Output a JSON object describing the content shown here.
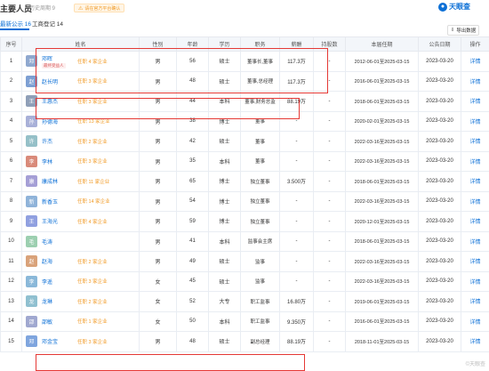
{
  "header": {
    "title": "主要人员",
    "history": "历史周期 9",
    "warning": "请在官方平台确认",
    "brand": "天眼查"
  },
  "tabs": [
    {
      "label": "最新公示 16"
    },
    {
      "label": "工商登记 14"
    }
  ],
  "export_label": "导出数据",
  "columns": [
    "序号",
    "姓名",
    "性别",
    "年龄",
    "学历",
    "职务",
    "薪酬",
    "持股数",
    "本届任期",
    "公告日期",
    "操作"
  ],
  "rows": [
    {
      "no": "1",
      "name": "邓晖",
      "badge": "最终受益人",
      "avatar": "邓",
      "corp": "任职 4 家企业",
      "gender": "男",
      "age": "56",
      "edu": "硕士",
      "position": "董事长,董事",
      "salary": "117.3万",
      "shares": "-",
      "term": "2012-06-01至2025-03-15",
      "date": "2023-03-20",
      "op": "详情"
    },
    {
      "no": "2",
      "name": "赵长明",
      "badge": "",
      "avatar": "赵",
      "corp": "任职 3 家企业",
      "gender": "男",
      "age": "48",
      "edu": "硕士",
      "position": "董事,总经理",
      "salary": "117.3万",
      "shares": "-",
      "term": "2016-06-01至2025-03-15",
      "date": "2023-03-20",
      "op": "详情"
    },
    {
      "no": "3",
      "name": "王惠杰",
      "badge": "",
      "avatar": "王",
      "corp": "任职 3 家企业",
      "gender": "男",
      "age": "44",
      "edu": "本科",
      "position": "董事,财务总监",
      "salary": "88.19万",
      "shares": "-",
      "term": "2018-06-01至2025-03-15",
      "date": "2023-03-20",
      "op": "详情"
    },
    {
      "no": "4",
      "name": "孙德海",
      "badge": "",
      "avatar": "孙",
      "corp": "任职 13 家企业",
      "gender": "男",
      "age": "38",
      "edu": "博士",
      "position": "董事",
      "salary": "-",
      "shares": "-",
      "term": "2020-02-01至2025-03-15",
      "date": "2023-03-20",
      "op": "详情"
    },
    {
      "no": "5",
      "name": "许杰",
      "badge": "",
      "avatar": "许",
      "corp": "任职 2 家企业",
      "gender": "男",
      "age": "42",
      "edu": "硕士",
      "position": "董事",
      "salary": "-",
      "shares": "-",
      "term": "2022-03-16至2025-03-15",
      "date": "2023-03-20",
      "op": "详情"
    },
    {
      "no": "6",
      "name": "李林",
      "badge": "",
      "avatar": "李",
      "corp": "任职 3 家企业",
      "gender": "男",
      "age": "35",
      "edu": "本科",
      "position": "董事",
      "salary": "-",
      "shares": "-",
      "term": "2022-03-16至2025-03-15",
      "date": "2023-03-20",
      "op": "详情"
    },
    {
      "no": "7",
      "name": "康成林",
      "badge": "",
      "avatar": "康",
      "corp": "任职 11 家企业",
      "gender": "男",
      "age": "65",
      "edu": "博士",
      "position": "独立董事",
      "salary": "3.500万",
      "shares": "-",
      "term": "2018-06-01至2025-03-15",
      "date": "2023-03-20",
      "op": "详情"
    },
    {
      "no": "8",
      "name": "新香玉",
      "badge": "",
      "avatar": "新",
      "corp": "任职 14 家企业",
      "gender": "男",
      "age": "54",
      "edu": "博士",
      "position": "独立董事",
      "salary": "-",
      "shares": "-",
      "term": "2022-03-16至2025-03-15",
      "date": "2023-03-20",
      "op": "详情"
    },
    {
      "no": "9",
      "name": "王海光",
      "badge": "",
      "avatar": "王",
      "corp": "任职 4 家企业",
      "gender": "男",
      "age": "59",
      "edu": "博士",
      "position": "独立董事",
      "salary": "-",
      "shares": "-",
      "term": "2020-12-01至2025-03-15",
      "date": "2023-03-20",
      "op": "详情"
    },
    {
      "no": "10",
      "name": "毛涛",
      "badge": "",
      "avatar": "毛",
      "corp": "",
      "gender": "男",
      "age": "41",
      "edu": "本科",
      "position": "监事会主席",
      "salary": "-",
      "shares": "-",
      "term": "2018-06-01至2025-03-15",
      "date": "2023-03-20",
      "op": "详情"
    },
    {
      "no": "11",
      "name": "赵海",
      "badge": "",
      "avatar": "赵",
      "corp": "任职 2 家企业",
      "gender": "男",
      "age": "49",
      "edu": "硕士",
      "position": "监事",
      "salary": "-",
      "shares": "-",
      "term": "2022-03-16至2025-03-15",
      "date": "2023-03-20",
      "op": "详情"
    },
    {
      "no": "12",
      "name": "李遥",
      "badge": "",
      "avatar": "李",
      "corp": "任职 3 家企业",
      "gender": "女",
      "age": "45",
      "edu": "硕士",
      "position": "监事",
      "salary": "-",
      "shares": "-",
      "term": "2022-03-16至2025-03-15",
      "date": "2023-03-20",
      "op": "详情"
    },
    {
      "no": "13",
      "name": "龙琳",
      "badge": "",
      "avatar": "龙",
      "corp": "任职 2 家企业",
      "gender": "女",
      "age": "52",
      "edu": "大专",
      "position": "职工监事",
      "salary": "16.80万",
      "shares": "-",
      "term": "2019-06-01至2025-03-15",
      "date": "2023-03-20",
      "op": "详情"
    },
    {
      "no": "14",
      "name": "邵敏",
      "badge": "",
      "avatar": "邵",
      "corp": "任职 1 家企业",
      "gender": "女",
      "age": "50",
      "edu": "本科",
      "position": "职工监事",
      "salary": "9.350万",
      "shares": "-",
      "term": "2016-06-01至2025-03-15",
      "date": "2023-03-20",
      "op": "详情"
    },
    {
      "no": "15",
      "name": "邓金宝",
      "badge": "",
      "avatar": "邓",
      "corp": "任职 3 家企业",
      "gender": "男",
      "age": "48",
      "edu": "硕士",
      "position": "副总经理",
      "salary": "88.19万",
      "shares": "-",
      "term": "2018-11-01至2025-03-15",
      "date": "2023-03-20",
      "op": "详情"
    }
  ],
  "colors": {
    "accent": "#0b6fd6",
    "corp": "#f19b27",
    "highlight": "#e53935",
    "avatars": [
      "#8fa8cf",
      "#7d9fd3",
      "#8f9fb8",
      "#a8b0d8",
      "#95c0c8",
      "#d98a7a",
      "#a59fd6",
      "#8fb3d9",
      "#90a0e0",
      "#9ccfb0",
      "#d9a27a",
      "#8ab8d9",
      "#90c0d0",
      "#a0a8d0",
      "#7fa5de"
    ]
  },
  "watermark": "©天眼查"
}
